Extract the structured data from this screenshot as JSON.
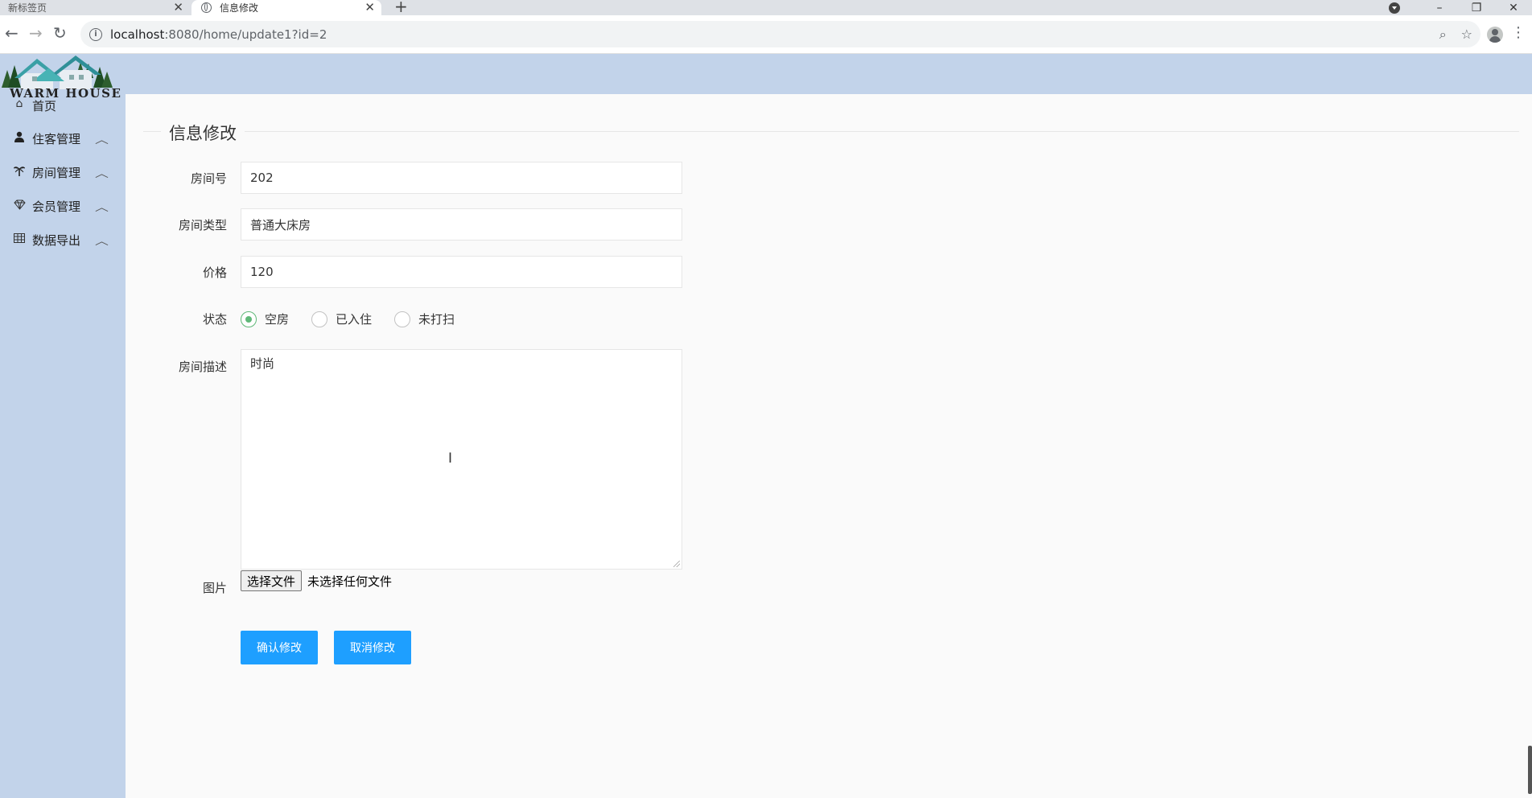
{
  "browser": {
    "tabs": [
      {
        "title": "新标签页",
        "active": false
      },
      {
        "title": "信息修改",
        "active": true
      }
    ],
    "new_tab_symbol": "+",
    "close_symbol": "✕",
    "url_host": "localhost",
    "url_path": ":8080/home/update1?id=2"
  },
  "logo": {
    "text": "WARM HOUSE"
  },
  "sidebar": {
    "items": [
      {
        "label": "首页",
        "icon": "home-icon"
      },
      {
        "label": "住客管理",
        "icon": "user-icon"
      },
      {
        "label": "房间管理",
        "icon": "palm-icon"
      },
      {
        "label": "会员管理",
        "icon": "diamond-icon"
      },
      {
        "label": "数据导出",
        "icon": "table-icon"
      }
    ]
  },
  "form": {
    "title": "信息修改",
    "room_number": {
      "label": "房间号",
      "value": "202"
    },
    "room_type": {
      "label": "房间类型",
      "value": "普通大床房"
    },
    "price": {
      "label": "价格",
      "value": "120"
    },
    "status": {
      "label": "状态",
      "options": [
        "空房",
        "已入住",
        "未打扫"
      ],
      "selected": "空房"
    },
    "description": {
      "label": "房间描述",
      "value": "时尚"
    },
    "image": {
      "label": "图片",
      "button_label": "选择文件",
      "no_file_text": "未选择任何文件"
    },
    "confirm_label": "确认修改",
    "cancel_label": "取消修改"
  },
  "colors": {
    "sidebar_bg": "#c2d3ea",
    "primary_button": "#1e9fff",
    "radio_checked": "#5fb878"
  }
}
